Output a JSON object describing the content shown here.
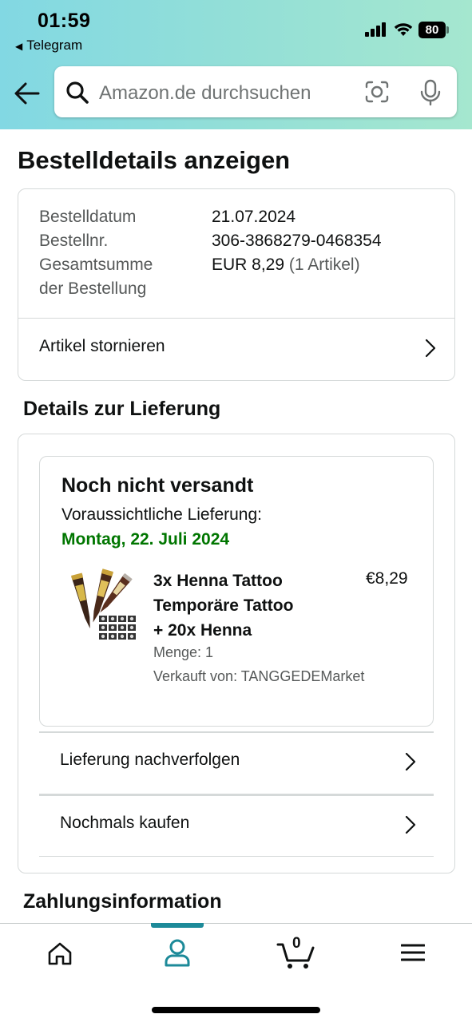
{
  "status_bar": {
    "time": "01:59",
    "back_app": "Telegram",
    "battery": "80"
  },
  "search": {
    "placeholder": "Amazon.de durchsuchen"
  },
  "page": {
    "title": "Bestelldetails anzeigen"
  },
  "order": {
    "date_label": "Bestelldatum",
    "date_value": "21.07.2024",
    "number_label": "Bestellnr.",
    "number_value": "306-3868279-0468354",
    "total_label_line1": "Gesamtsumme",
    "total_label_line2": "der Bestellung",
    "total_value": "EUR 8,29",
    "total_count": "(1 Artikel)",
    "cancel_label": "Artikel stornieren"
  },
  "delivery": {
    "section_title": "Details zur Lieferung",
    "status": "Noch nicht versandt",
    "estimate_label": "Voraussichtliche Lieferung:",
    "estimate_date": "Montag, 22. Juli 2024",
    "item": {
      "title_line1": "3x Henna Tattoo",
      "title_line2": "Temporäre Tattoo",
      "title_line3": "+ 20x Henna",
      "price": "€8,29",
      "quantity": "Menge: 1",
      "seller": "Verkauft von: TANGGEDEMarket"
    },
    "track_label": "Lieferung nachverfolgen",
    "buy_again_label": "Nochmals kaufen"
  },
  "payment": {
    "section_title": "Zahlungsinformation"
  },
  "tabbar": {
    "cart_count": "0",
    "active_tab": "account",
    "accent_color": "#1d8a99"
  },
  "colors": {
    "delivery_green": "#007600",
    "header_gradient_start": "#82d8e3",
    "header_gradient_end": "#a5e7cf"
  }
}
